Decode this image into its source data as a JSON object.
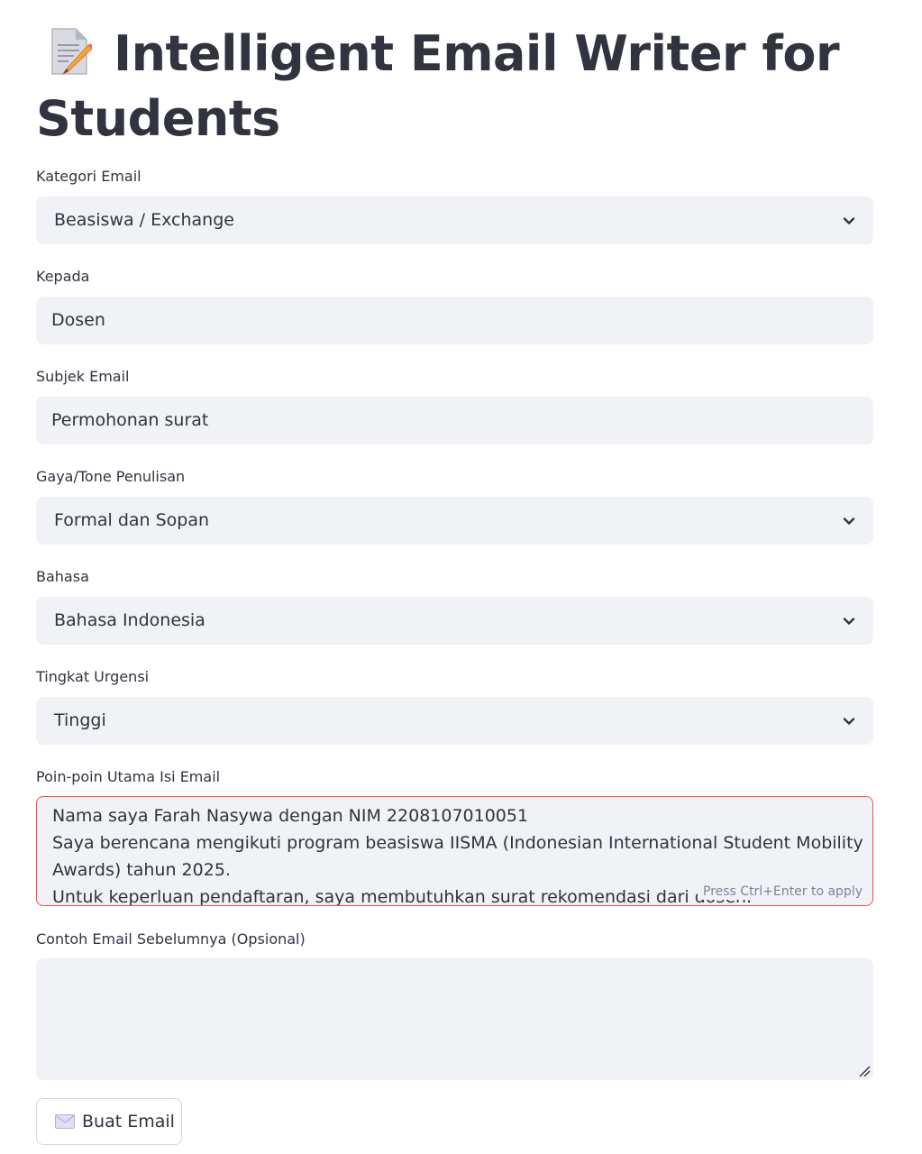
{
  "header": {
    "title_line1": "Intelligent Email Writer for",
    "title_line2": "Students",
    "title_icon": "memo-icon"
  },
  "form": {
    "kategori": {
      "label": "Kategori Email",
      "value": "Beasiswa / Exchange"
    },
    "kepada": {
      "label": "Kepada",
      "value": "Dosen"
    },
    "subjek": {
      "label": "Subjek Email",
      "value": "Permohonan surat"
    },
    "tone": {
      "label": "Gaya/Tone Penulisan",
      "value": "Formal dan Sopan"
    },
    "bahasa": {
      "label": "Bahasa",
      "value": "Bahasa Indonesia"
    },
    "urgensi": {
      "label": "Tingkat Urgensi",
      "value": "Tinggi"
    },
    "poin": {
      "label": "Poin-poin Utama Isi Email",
      "lines": [
        "Nama saya Farah Nasywa dengan NIM 2208107010051",
        "Saya berencana mengikuti program beasiswa IISMA (Indonesian International Student Mobility",
        "Awards) tahun 2025.",
        "Untuk keperluan pendaftaran, saya membutuhkan surat rekomendasi dari dosen."
      ],
      "hint": "Press Ctrl+Enter to apply"
    },
    "contoh": {
      "label": "Contoh Email Sebelumnya (Opsional)",
      "value": ""
    },
    "submit": {
      "label": "Buat Email",
      "icon": "envelope-icon"
    }
  },
  "colors": {
    "text": "#31333f",
    "field_bg": "#f0f2f6",
    "focus_border": "#ff4b4b",
    "hint": "#808495"
  }
}
